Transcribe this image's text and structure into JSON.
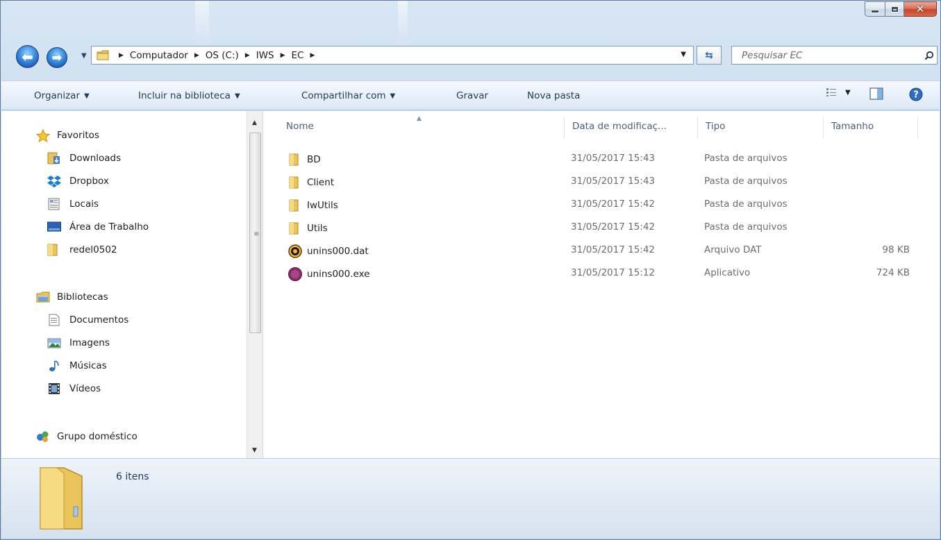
{
  "window": {
    "caption_buttons": {
      "minimize": "minimize-icon",
      "maximize": "maximize-icon",
      "close": "close-icon"
    }
  },
  "address": {
    "breadcrumbs": [
      "Computador",
      "OS (C:)",
      "IWS",
      "EC"
    ]
  },
  "search": {
    "placeholder": "Pesquisar EC"
  },
  "toolbar": {
    "organize": "Organizar",
    "include_library": "Incluir na biblioteca",
    "share": "Compartilhar com",
    "burn": "Gravar",
    "new_folder": "Nova pasta"
  },
  "sidebar": {
    "favorites": {
      "label": "Favoritos",
      "items": [
        "Downloads",
        "Dropbox",
        "Locais",
        "Área de Trabalho",
        "redel0502"
      ]
    },
    "libraries": {
      "label": "Bibliotecas",
      "items": [
        "Documentos",
        "Imagens",
        "Músicas",
        "Vídeos"
      ]
    },
    "homegroup": "Grupo doméstico"
  },
  "columns": {
    "name": "Nome",
    "date": "Data de modificaç...",
    "type": "Tipo",
    "size": "Tamanho"
  },
  "files": [
    {
      "name": "BD",
      "date": "31/05/2017 15:43",
      "type": "Pasta de arquivos",
      "size": "",
      "icon": "folder-icon"
    },
    {
      "name": "Client",
      "date": "31/05/2017 15:43",
      "type": "Pasta de arquivos",
      "size": "",
      "icon": "folder-icon"
    },
    {
      "name": "IwUtils",
      "date": "31/05/2017 15:42",
      "type": "Pasta de arquivos",
      "size": "",
      "icon": "folder-icon"
    },
    {
      "name": "Utils",
      "date": "31/05/2017 15:42",
      "type": "Pasta de arquivos",
      "size": "",
      "icon": "folder-icon"
    },
    {
      "name": "unins000.dat",
      "date": "31/05/2017 15:42",
      "type": "Arquivo DAT",
      "size": "98 KB",
      "icon": "ue-file-icon"
    },
    {
      "name": "unins000.exe",
      "date": "31/05/2017 15:12",
      "type": "Aplicativo",
      "size": "724 KB",
      "icon": "ec-app-icon"
    }
  ],
  "status": {
    "count": "6 itens"
  },
  "colors": {
    "accent": "#1e395b",
    "frame": "#c5d7ea",
    "toolbar": "#e9f1fa"
  }
}
